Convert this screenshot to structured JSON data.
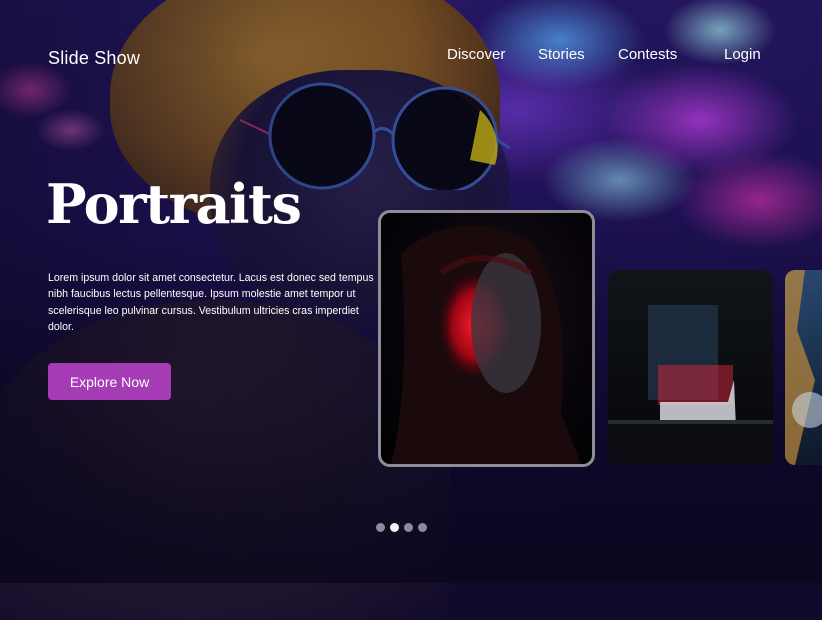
{
  "brand": {
    "title": "Slide Show"
  },
  "nav": {
    "items": [
      {
        "label": "Discover"
      },
      {
        "label": "Stories"
      },
      {
        "label": "Contests"
      }
    ],
    "login_label": "Login"
  },
  "hero": {
    "title": "Portraits",
    "description": "Lorem ipsum dolor sit amet consectetur. Lacus est donec sed tempus nibh faucibus lectus pellentesque. Ipsum molestie amet tempor ut scelerisque leo pulvinar cursus. Vestibulum ultricies cras imperdiet dolor.",
    "cta_label": "Explore Now",
    "cta_color": "#a63bb6"
  },
  "carousel": {
    "cards": [
      {
        "icon": "portrait-photo",
        "active": true
      },
      {
        "icon": "chair-photo",
        "active": false
      },
      {
        "icon": "partial-photo",
        "active": false
      }
    ],
    "pager": {
      "count": 4,
      "active_index": 1
    }
  }
}
